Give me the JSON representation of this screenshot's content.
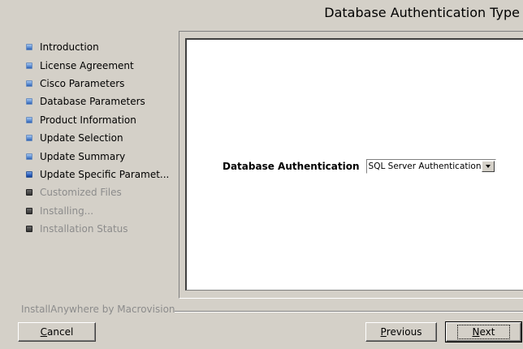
{
  "header": {
    "title": "Database Authentication Type"
  },
  "steps": [
    {
      "label": "Introduction",
      "state": "done"
    },
    {
      "label": "License Agreement",
      "state": "done"
    },
    {
      "label": "Cisco Parameters",
      "state": "done"
    },
    {
      "label": "Database Parameters",
      "state": "done"
    },
    {
      "label": "Product Information",
      "state": "done"
    },
    {
      "label": "Update Selection",
      "state": "done"
    },
    {
      "label": "Update Summary",
      "state": "done"
    },
    {
      "label": "Update Specific Paramet...",
      "state": "current"
    },
    {
      "label": "Customized Files",
      "state": "pending"
    },
    {
      "label": "Installing...",
      "state": "pending"
    },
    {
      "label": "Installation Status",
      "state": "pending"
    }
  ],
  "form": {
    "auth_label": "Database Authentication",
    "auth_value": "SQL Server Authentication"
  },
  "footer": {
    "vendor": "InstallAnywhere by Macrovision",
    "cancel_mnemonic": "C",
    "cancel_rest": "ancel",
    "previous_mnemonic": "P",
    "previous_rest": "revious",
    "next_mnemonic": "N",
    "next_rest": "ext"
  },
  "icons": {
    "step_done": "blue-bullet-icon",
    "step_pending": "dark-bullet-icon",
    "dropdown": "chevron-down-icon"
  }
}
